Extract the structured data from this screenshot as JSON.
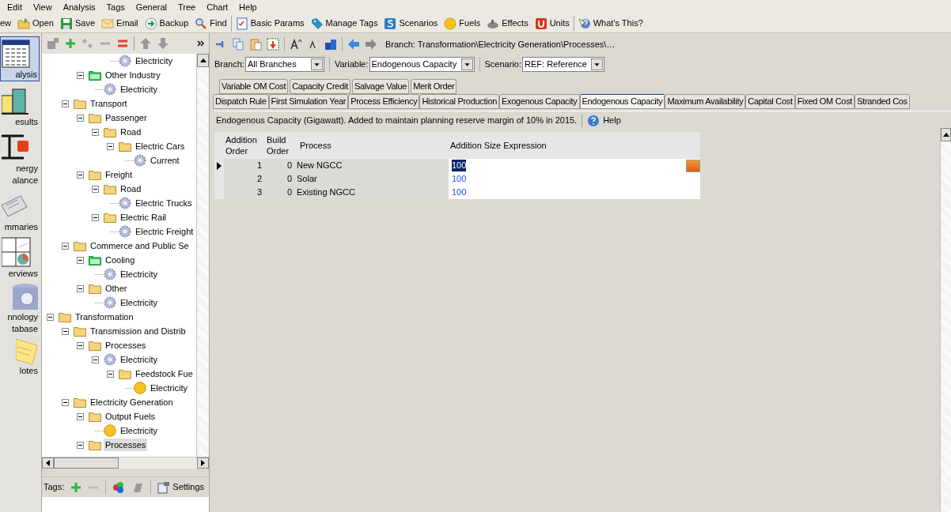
{
  "menu": [
    "Edit",
    "View",
    "Analysis",
    "Tags",
    "General",
    "Tree",
    "Chart",
    "Help"
  ],
  "toolbar": [
    [
      {
        "label": "ew",
        "kind": "new"
      },
      {
        "label": "Open",
        "kind": "open"
      },
      {
        "label": "Save",
        "kind": "save"
      },
      {
        "label": "Email",
        "kind": "email"
      },
      {
        "label": "Backup",
        "kind": "backup"
      },
      {
        "label": "Find",
        "kind": "find"
      }
    ],
    [
      {
        "label": "Basic Params",
        "kind": "params"
      },
      {
        "label": "Manage Tags",
        "kind": "tag"
      },
      {
        "label": "Scenarios",
        "kind": "scenarios"
      },
      {
        "label": "Fuels",
        "kind": "fuel"
      },
      {
        "label": "Effects",
        "kind": "effects"
      },
      {
        "label": "Units",
        "kind": "units"
      }
    ],
    [
      {
        "label": "What's This?",
        "kind": "help"
      }
    ]
  ],
  "views": [
    {
      "lines": [
        "alysis"
      ],
      "kind": "analysis",
      "selected": true
    },
    {
      "lines": [
        "esults"
      ],
      "kind": "results",
      "selected": false
    },
    {
      "lines": [
        "nergy",
        "alance"
      ],
      "kind": "balance",
      "selected": false
    },
    {
      "lines": [
        "mmaries"
      ],
      "kind": "summaries",
      "selected": false
    },
    {
      "lines": [
        "erviews"
      ],
      "kind": "overviews",
      "selected": false
    },
    {
      "lines": [
        "nnology",
        "tabase"
      ],
      "kind": "database",
      "selected": false
    },
    {
      "lines": [
        "lotes"
      ],
      "kind": "notes",
      "selected": false
    }
  ],
  "tree": [
    {
      "children": [
        {
          "children": [
            {
              "children": [
                {
                  "children": [
                    {
                      "label": "Electricity",
                      "kind": "gear"
                    }
                  ]
                }
              ]
            },
            {
              "label": "Other Industry",
              "kind": "green-folder",
              "expanded": true,
              "children": [
                {
                  "label": "Electricity",
                  "kind": "gear"
                }
              ]
            }
          ]
        },
        {
          "label": "Transport",
          "kind": "folder",
          "expanded": true,
          "children": [
            {
              "label": "Passenger",
              "kind": "folder",
              "expanded": true,
              "children": [
                {
                  "label": "Road",
                  "kind": "folder",
                  "expanded": true,
                  "children": [
                    {
                      "label": "Electric Cars",
                      "kind": "folder",
                      "expanded": true,
                      "children": [
                        {
                          "label": "Current",
                          "kind": "gear"
                        }
                      ]
                    }
                  ]
                }
              ]
            },
            {
              "label": "Freight",
              "kind": "folder",
              "expanded": true,
              "children": [
                {
                  "label": "Road",
                  "kind": "folder",
                  "expanded": true,
                  "children": [
                    {
                      "label": "Electric Trucks",
                      "kind": "gear"
                    }
                  ]
                },
                {
                  "label": "Electric Rail",
                  "kind": "folder",
                  "expanded": true,
                  "children": [
                    {
                      "label": "Electric Freight",
                      "kind": "gear"
                    }
                  ]
                }
              ]
            }
          ]
        },
        {
          "label": "Commerce and Public Se",
          "kind": "folder",
          "expanded": true,
          "children": [
            {
              "label": "Cooling",
              "kind": "green-folder",
              "expanded": true,
              "children": [
                {
                  "label": "Electricity",
                  "kind": "gear"
                }
              ]
            },
            {
              "label": "Other",
              "kind": "folder",
              "expanded": true,
              "children": [
                {
                  "label": "Electricity",
                  "kind": "gear"
                }
              ]
            }
          ]
        }
      ]
    },
    {
      "label": "Transformation",
      "kind": "folder",
      "expanded": true,
      "children": [
        {
          "label": "Transmission and Distrib",
          "kind": "folder",
          "expanded": true,
          "children": [
            {
              "label": "Processes",
              "kind": "folder",
              "expanded": true,
              "children": [
                {
                  "label": "Electricity",
                  "kind": "gear",
                  "expanded": true,
                  "children": [
                    {
                      "label": "Feedstock Fue",
                      "kind": "folder",
                      "expanded": true,
                      "children": [
                        {
                          "label": "Electricity",
                          "kind": "fuel"
                        }
                      ]
                    }
                  ]
                }
              ]
            }
          ]
        },
        {
          "label": "Electricity Generation",
          "kind": "folder",
          "expanded": true,
          "children": [
            {
              "label": "Output Fuels",
              "kind": "folder",
              "expanded": true,
              "children": [
                {
                  "label": "Electricity",
                  "kind": "fuel"
                }
              ]
            },
            {
              "label": "Processes",
              "kind": "folder",
              "expanded": true,
              "selected": true
            }
          ]
        }
      ]
    }
  ],
  "tags_bar": {
    "label": "Tags:",
    "settings": "Settings"
  },
  "breadcrumb": "Branch: Transformation\\Electricity Generation\\Processes\\…",
  "selectors": [
    {
      "label": "Branch:",
      "value": "All Branches"
    },
    {
      "label": "Variable:",
      "value": "Endogenous Capacity"
    },
    {
      "label": "Scenario:",
      "value": "REF: Reference"
    }
  ],
  "tab_rows": [
    [
      {
        "label": "Variable OM Cost",
        "selected": false
      },
      {
        "label": "Capacity Credit",
        "selected": false
      },
      {
        "label": "Salvage Value",
        "selected": false
      },
      {
        "label": "Merit Order",
        "selected": false
      }
    ],
    [
      {
        "label": "Dispatch Rule",
        "selected": false
      },
      {
        "label": "First Simulation Year",
        "selected": false
      },
      {
        "label": "Process Efficiency",
        "selected": false
      },
      {
        "label": "Historical Production",
        "selected": false
      },
      {
        "label": "Exogenous Capacity",
        "selected": false
      },
      {
        "label": "Endogenous Capacity",
        "selected": true
      },
      {
        "label": "Maximum Availability",
        "selected": false
      },
      {
        "label": "Capital Cost",
        "selected": false
      },
      {
        "label": "Fixed OM Cost",
        "selected": false
      },
      {
        "label": "Stranded Cos",
        "selected": false
      }
    ]
  ],
  "info": {
    "text": "Endogenous Capacity (Gigawatt).  Added to maintain planning reserve margin of 10% in 2015.",
    "help": "Help"
  },
  "table": {
    "columns": [
      "Addition Order",
      "Build Order",
      "Process",
      "Addition Size Expression"
    ],
    "rows": [
      {
        "addition_order": "1",
        "build_order": "0",
        "process": "New NGCC",
        "expression": "100",
        "selected": true
      },
      {
        "addition_order": "2",
        "build_order": "0",
        "process": "Solar",
        "expression": "100",
        "selected": false
      },
      {
        "addition_order": "3",
        "build_order": "0",
        "process": "Existing NGCC",
        "expression": "100",
        "selected": false
      }
    ]
  }
}
